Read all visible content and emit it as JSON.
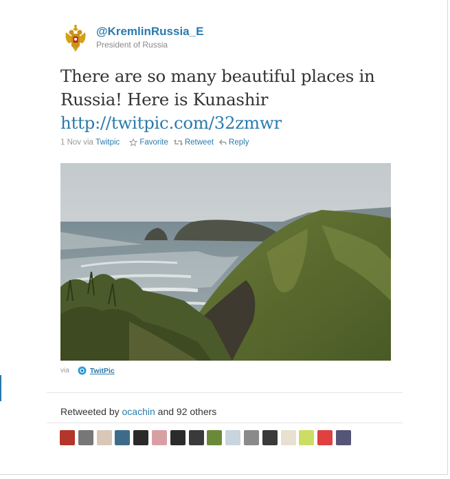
{
  "account": {
    "screen_name": "@KremlinRussia_E",
    "full_name": "President of Russia",
    "avatar_icon": "coat-of-arms-icon"
  },
  "tweet": {
    "text": "There are so many beautiful places in Russia! Here is Kunashir",
    "link": "http://twitpic.com/32zmwr"
  },
  "meta": {
    "date": "1 Nov",
    "via_label": "via",
    "source": "Twitpic",
    "actions": {
      "favorite": "Favorite",
      "retweet": "Retweet",
      "reply": "Reply"
    }
  },
  "media": {
    "via_label": "via",
    "provider": "TwitPic",
    "provider_icon": "twitpic-logo-icon"
  },
  "retweets": {
    "prefix": "Retweeted by",
    "user": "ocachin",
    "suffix": "and 92 others",
    "avatars": [
      {
        "color": "#b4352a"
      },
      {
        "color": "#777777"
      },
      {
        "color": "#d9c7b8"
      },
      {
        "color": "#3d6c8a"
      },
      {
        "color": "#2a2a2a"
      },
      {
        "color": "#d9a0a4"
      },
      {
        "color": "#2b2b2b"
      },
      {
        "color": "#3a3a3a"
      },
      {
        "color": "#6a8a3a"
      },
      {
        "color": "#c8d4de"
      },
      {
        "color": "#8a8a8a"
      },
      {
        "color": "#3a3a3a"
      },
      {
        "color": "#e8e0d0"
      },
      {
        "color": "#ccdd66"
      },
      {
        "color": "#e04040"
      },
      {
        "color": "#555577"
      }
    ]
  }
}
